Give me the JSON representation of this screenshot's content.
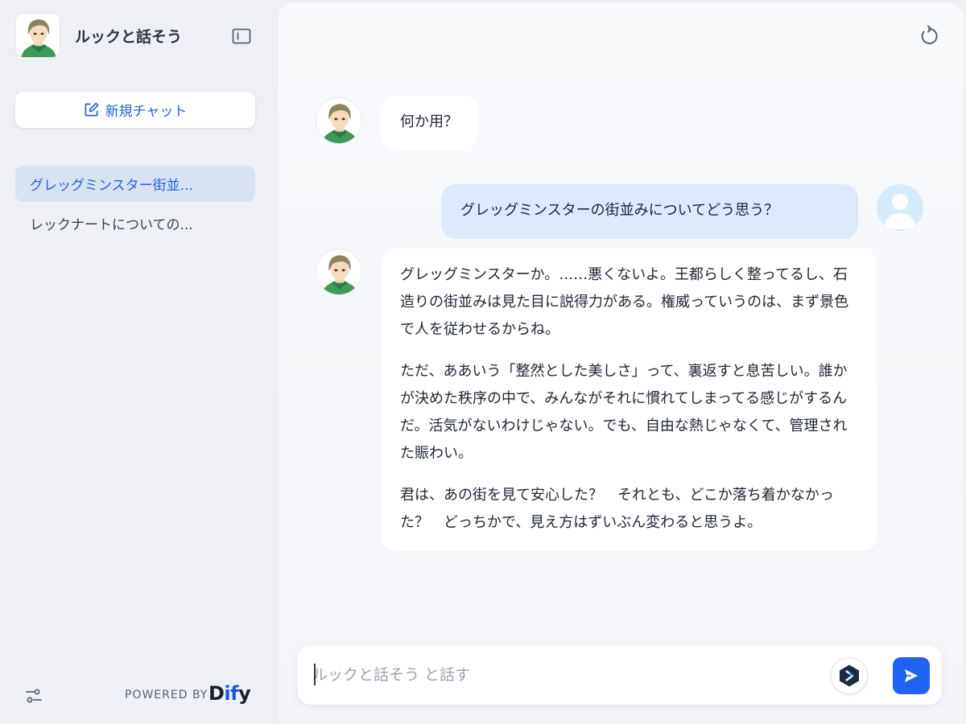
{
  "app": {
    "title": "ルックと話そう"
  },
  "sidebar": {
    "new_chat_label": "新規チャット",
    "conversations": [
      {
        "label": "グレッグミンスター街並...",
        "active": true
      },
      {
        "label": "レックナートについての...",
        "active": false
      }
    ],
    "powered_by": "POWERED BY",
    "brand": {
      "part1": "D",
      "part2": "if",
      "part3": "y"
    }
  },
  "chat": {
    "messages": [
      {
        "role": "bot",
        "paragraphs": [
          "何か用？"
        ]
      },
      {
        "role": "user",
        "paragraphs": [
          "グレッグミンスターの街並みについてどう思う？"
        ]
      },
      {
        "role": "bot",
        "paragraphs": [
          "グレッグミンスターか。……悪くないよ。王都らしく整ってるし、石造りの街並みは見た目に説得力がある。権威っていうのは、まず景色で人を従わせるからね。",
          "ただ、ああいう「整然とした美しさ」って、裏返すと息苦しい。誰かが決めた秩序の中で、みんながそれに慣れてしまってる感じがするんだ。活気がないわけじゃない。でも、自由な熱じゃなくて、管理された賑わい。",
          "君は、あの街を見て安心した？　それとも、どこか落ち着かなかった？　どっちかで、見え方はずいぶん変わると思うよ。"
        ]
      }
    ],
    "input": {
      "placeholder": "ルックと話そう と話す",
      "value": ""
    }
  },
  "colors": {
    "accent": "#1f63f2",
    "user_bubble": "#dbe9fb",
    "sidebar_active": "#d9e2f3",
    "sidebar_bg": "#eef0f5"
  },
  "icons": {
    "sidebar_toggle": "panel-left-icon",
    "new_chat": "edit-icon",
    "reset": "refresh-icon",
    "settings": "sliders-icon",
    "tool": "hexagon-tool-icon",
    "send": "send-icon"
  }
}
